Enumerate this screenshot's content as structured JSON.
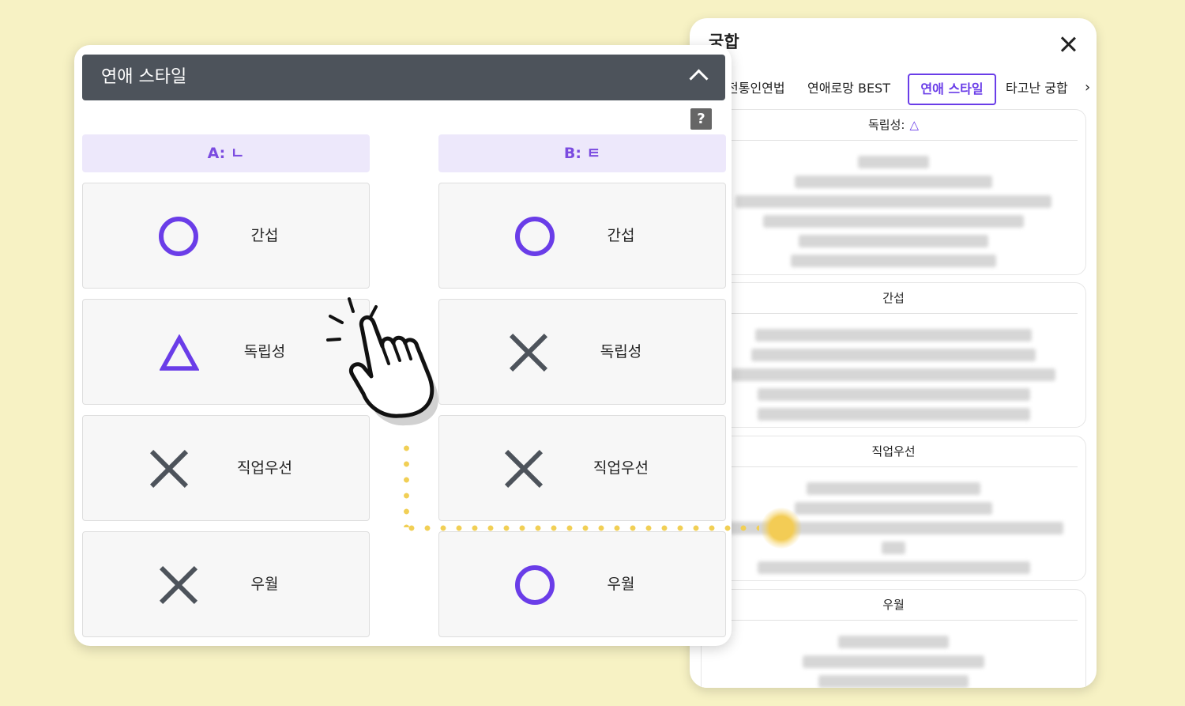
{
  "right_panel": {
    "title": "궁합",
    "tabs": [
      "전통인연법",
      "연애로망 BEST",
      "연애 스타일",
      "타고난 궁합"
    ],
    "active_tab": "연애 스타일",
    "next_tab_glyph": "›",
    "cards": [
      {
        "title": "독립성:",
        "symbol": "△"
      },
      {
        "title": "간섭"
      },
      {
        "title": "직업우선"
      },
      {
        "title": "우월"
      }
    ]
  },
  "left_panel": {
    "header_title": "연애 스타일",
    "help_label": "?",
    "col_a_label": "A: ㄴ",
    "col_b_label": "B: ㅌ",
    "rows": [
      {
        "label": "간섭",
        "a": "O",
        "b": "O"
      },
      {
        "label": "독립성",
        "a": "△",
        "b": "X"
      },
      {
        "label": "직업우선",
        "a": "X",
        "b": "X"
      },
      {
        "label": "우월",
        "a": "X",
        "b": "O"
      }
    ]
  },
  "colors": {
    "accent": "#6a3de8",
    "header_bg": "#4d535b",
    "column_header_bg": "#ede8fb",
    "connector": "#f1cf55",
    "page_bg": "#f7f2c4"
  }
}
